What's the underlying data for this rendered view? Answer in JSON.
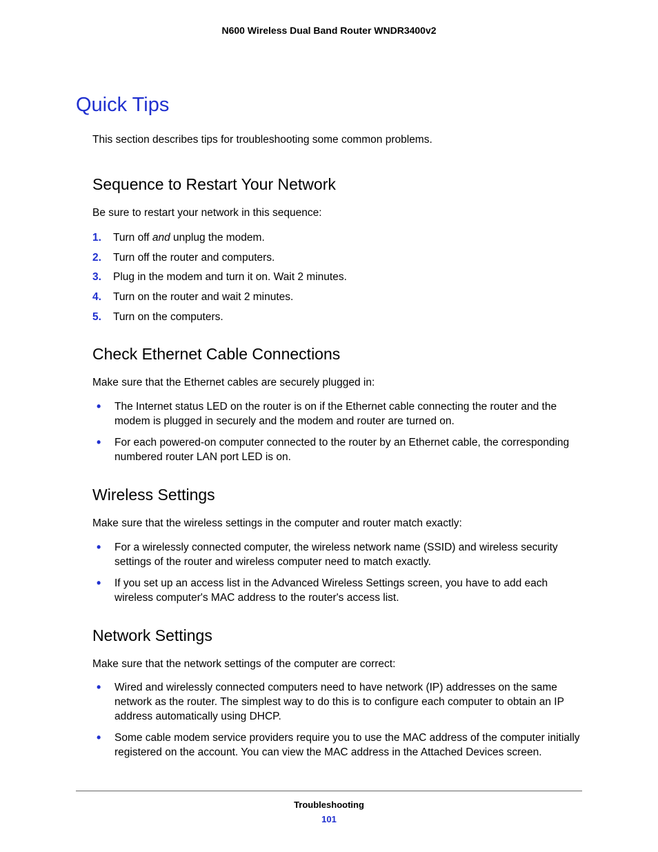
{
  "header": {
    "title": "N600 Wireless Dual Band Router WNDR3400v2"
  },
  "main": {
    "title": "Quick Tips",
    "intro": "This section describes tips for troubleshooting some common problems.",
    "sections": [
      {
        "heading": "Sequence to Restart Your Network",
        "lead": "Be sure to restart your network in this sequence:",
        "ordered": [
          {
            "pre": "Turn off ",
            "em": "and",
            "post": " unplug the modem."
          },
          {
            "text": "Turn off the router and computers."
          },
          {
            "text": "Plug in the modem and turn it on. Wait 2 minutes."
          },
          {
            "text": "Turn on the router and wait 2 minutes."
          },
          {
            "text": "Turn on the computers."
          }
        ]
      },
      {
        "heading": "Check Ethernet Cable Connections",
        "lead": "Make sure that the Ethernet cables are securely plugged in:",
        "bullets": [
          "The Internet status LED on the router is on if the Ethernet cable connecting the router and the modem is plugged in securely and the modem and router are turned on.",
          " For each powered-on computer connected to the router by an Ethernet cable, the corresponding numbered router LAN port LED is on."
        ]
      },
      {
        "heading": "Wireless Settings",
        "lead": "Make sure that the wireless settings in the computer and router match exactly:",
        "bullets": [
          " For a wirelessly connected computer, the wireless network name (SSID) and wireless security settings of the router and wireless computer need to match exactly.",
          " If you set up an access list in the Advanced Wireless Settings screen, you have to add each wireless computer's MAC address to the router's access list."
        ]
      },
      {
        "heading": "Network Settings",
        "lead": "Make sure that the network settings of the computer are correct:",
        "bullets": [
          " Wired and wirelessly connected computers need to have network (IP) addresses on the same network as the router. The simplest way to do this is to configure each computer to obtain an IP address automatically using DHCP.",
          " Some cable modem service providers require you to use the MAC address of the computer initially registered on the account. You can view the MAC address in the Attached Devices screen."
        ]
      }
    ]
  },
  "footer": {
    "chapter": "Troubleshooting",
    "page": "101"
  }
}
